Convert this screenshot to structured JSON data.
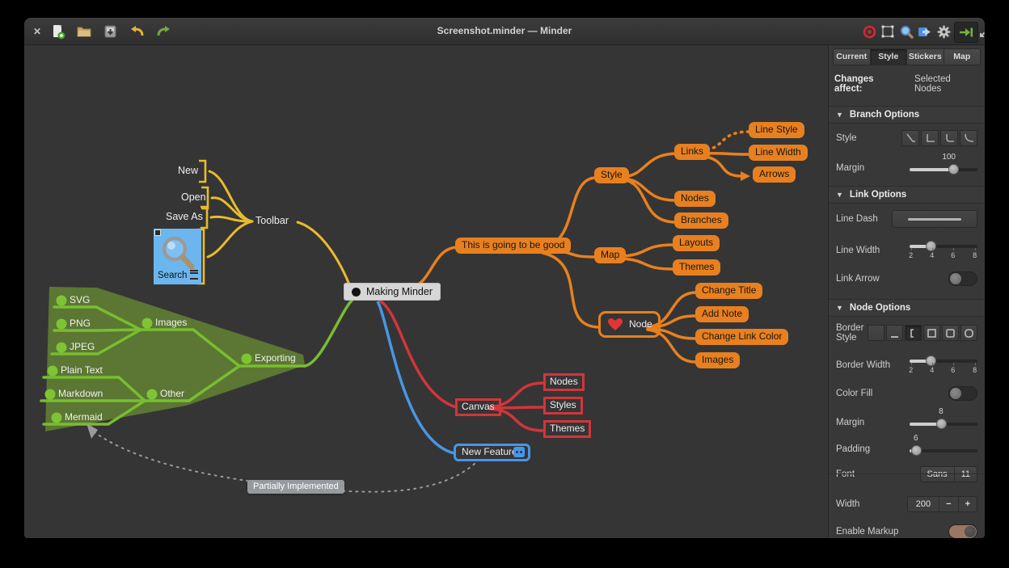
{
  "window": {
    "title": "Screenshot.minder — Minder",
    "close_glyph": "✕"
  },
  "sidebar": {
    "tabs": [
      {
        "label": "Current"
      },
      {
        "label": "Style"
      },
      {
        "label": "Stickers"
      },
      {
        "label": "Map"
      }
    ],
    "changes_affect": {
      "label": "Changes affect:",
      "value": "Selected Nodes"
    },
    "branch_options": {
      "title": "Branch Options",
      "style_label": "Style",
      "margin_label": "Margin",
      "margin_value": "100"
    },
    "link_options": {
      "title": "Link Options",
      "line_dash_label": "Line Dash",
      "line_width_label": "Line Width",
      "link_arrow_label": "Link Arrow"
    },
    "node_options": {
      "title": "Node Options",
      "border_style_label": "Border Style",
      "border_width_label": "Border Width",
      "color_fill_label": "Color Fill",
      "margin_label": "Margin",
      "margin_value": "8",
      "padding_label": "Padding",
      "padding_value": "6",
      "font_label": "Font",
      "font_family": "Sans",
      "font_size": "11",
      "width_label": "Width",
      "width_value": "200",
      "minus_glyph": "−",
      "plus_glyph": "+",
      "enable_markup_label": "Enable Markup"
    },
    "width_ticks": [
      "2",
      "4",
      "6",
      "8"
    ],
    "disclosure_glyph": "▼"
  },
  "map": {
    "nodes": {
      "root": "Making Minder",
      "toolbar": "Toolbar",
      "new": "New",
      "open": "Open",
      "save_as": "Save As",
      "search": "Search",
      "good": "This is going to be good",
      "style": "Style",
      "links": "Links",
      "line_style": "Line Style",
      "line_width": "Line Width",
      "arrows": "Arrows",
      "nodes": "Nodes",
      "branches": "Branches",
      "map": "Map",
      "layouts": "Layouts",
      "themes": "Themes",
      "node": "Node",
      "change_title": "Change Title",
      "add_note": "Add Note",
      "change_link_color": "Change Link Color",
      "node_images": "Images",
      "exporting": "Exporting",
      "images": "Images",
      "other": "Other",
      "svg": "SVG",
      "png": "PNG",
      "jpeg": "JPEG",
      "plain_text": "Plain Text",
      "markdown": "Markdown",
      "mermaid": "Mermaid",
      "canvas": "Canvas",
      "canvas_nodes": "Nodes",
      "canvas_styles": "Styles",
      "canvas_themes": "Themes",
      "new_features": "New Features",
      "connection_label": "Partially Implemented"
    },
    "colors": {
      "yellow": "#e7bb2e",
      "orange": "#e8801f",
      "green": "#79bd31",
      "red": "#d2353a",
      "blue": "#4796e8",
      "gray_link": "#9a9a9a",
      "selected_node_bg": "#d6d6d6"
    }
  }
}
